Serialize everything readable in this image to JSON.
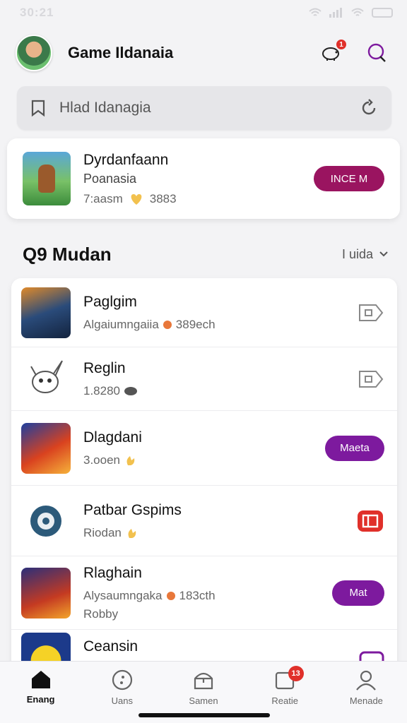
{
  "status_bar": {
    "time": "30:21"
  },
  "header": {
    "title": "Game Ildanaia",
    "notification_count": "1"
  },
  "search": {
    "text": "Hlad Idanagia"
  },
  "featured": {
    "name": "Dyrdanfaann",
    "subtitle": "Poanasia",
    "meta_left": "7:aasm",
    "meta_right": "3883",
    "button_label": "INCE M",
    "button_color": "#9a1460"
  },
  "section": {
    "title": "Q9 Mudan",
    "filter_label": "I uida"
  },
  "games": [
    {
      "name": "Paglgim",
      "meta": "Algaiumngaiia",
      "meta_right": "389ech",
      "action": "icon"
    },
    {
      "name": "Reglin",
      "meta": "1.8280",
      "action": "icon"
    },
    {
      "name": "Dlagdani",
      "meta": "3.ooen",
      "action": "pill",
      "action_label": "Maeta"
    },
    {
      "name": "Patbar Gspims",
      "meta": "Riodan",
      "action": "red-icon"
    },
    {
      "name": "Rlaghain",
      "meta": "Alysaumngaka",
      "meta_right": "183cth",
      "extra": "Robby",
      "action": "pill",
      "action_label": "Mat"
    },
    {
      "name": "Ceansin",
      "action": "partial"
    }
  ],
  "tabs": [
    {
      "label": "Enang",
      "icon": "home-icon",
      "active": true
    },
    {
      "label": "Uans",
      "icon": "compass-icon",
      "active": false
    },
    {
      "label": "Samen",
      "icon": "store-icon",
      "active": false
    },
    {
      "label": "Reatie",
      "icon": "messages-icon",
      "active": false,
      "badge": "13"
    },
    {
      "label": "Menade",
      "icon": "profile-icon",
      "active": false
    }
  ],
  "colors": {
    "accent_purple": "#7d1a9e",
    "accent_magenta": "#9a1460",
    "badge_red": "#e0302a"
  }
}
